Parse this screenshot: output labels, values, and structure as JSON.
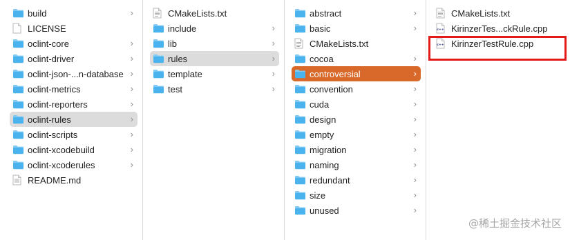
{
  "columns": [
    {
      "items": [
        {
          "label": "build",
          "icon": "folder-icon",
          "chevron": true,
          "selected": ""
        },
        {
          "label": "LICENSE",
          "icon": "document-icon",
          "chevron": false,
          "selected": ""
        },
        {
          "label": "oclint-core",
          "icon": "folder-icon",
          "chevron": true,
          "selected": ""
        },
        {
          "label": "oclint-driver",
          "icon": "folder-icon",
          "chevron": true,
          "selected": ""
        },
        {
          "label": "oclint-json-...n-database",
          "icon": "folder-icon",
          "chevron": true,
          "selected": ""
        },
        {
          "label": "oclint-metrics",
          "icon": "folder-icon",
          "chevron": true,
          "selected": ""
        },
        {
          "label": "oclint-reporters",
          "icon": "folder-icon",
          "chevron": true,
          "selected": ""
        },
        {
          "label": "oclint-rules",
          "icon": "folder-icon",
          "chevron": true,
          "selected": "gray"
        },
        {
          "label": "oclint-scripts",
          "icon": "folder-icon",
          "chevron": true,
          "selected": ""
        },
        {
          "label": "oclint-xcodebuild",
          "icon": "folder-icon",
          "chevron": true,
          "selected": ""
        },
        {
          "label": "oclint-xcoderules",
          "icon": "folder-icon",
          "chevron": true,
          "selected": ""
        },
        {
          "label": "README.md",
          "icon": "markdown-file-icon",
          "chevron": false,
          "selected": ""
        }
      ]
    },
    {
      "items": [
        {
          "label": "CMakeLists.txt",
          "icon": "text-file-icon",
          "chevron": false,
          "selected": ""
        },
        {
          "label": "include",
          "icon": "folder-icon",
          "chevron": true,
          "selected": ""
        },
        {
          "label": "lib",
          "icon": "folder-icon",
          "chevron": true,
          "selected": ""
        },
        {
          "label": "rules",
          "icon": "folder-icon",
          "chevron": true,
          "selected": "gray"
        },
        {
          "label": "template",
          "icon": "folder-icon",
          "chevron": true,
          "selected": ""
        },
        {
          "label": "test",
          "icon": "folder-icon",
          "chevron": true,
          "selected": ""
        }
      ]
    },
    {
      "items": [
        {
          "label": "abstract",
          "icon": "folder-icon",
          "chevron": true,
          "selected": ""
        },
        {
          "label": "basic",
          "icon": "folder-icon",
          "chevron": true,
          "selected": ""
        },
        {
          "label": "CMakeLists.txt",
          "icon": "text-file-icon",
          "chevron": false,
          "selected": ""
        },
        {
          "label": "cocoa",
          "icon": "folder-icon",
          "chevron": true,
          "selected": ""
        },
        {
          "label": "controversial",
          "icon": "folder-icon",
          "chevron": true,
          "selected": "orange"
        },
        {
          "label": "convention",
          "icon": "folder-icon",
          "chevron": true,
          "selected": ""
        },
        {
          "label": "cuda",
          "icon": "folder-icon",
          "chevron": true,
          "selected": ""
        },
        {
          "label": "design",
          "icon": "folder-icon",
          "chevron": true,
          "selected": ""
        },
        {
          "label": "empty",
          "icon": "folder-icon",
          "chevron": true,
          "selected": ""
        },
        {
          "label": "migration",
          "icon": "folder-icon",
          "chevron": true,
          "selected": ""
        },
        {
          "label": "naming",
          "icon": "folder-icon",
          "chevron": true,
          "selected": ""
        },
        {
          "label": "redundant",
          "icon": "folder-icon",
          "chevron": true,
          "selected": ""
        },
        {
          "label": "size",
          "icon": "folder-icon",
          "chevron": true,
          "selected": ""
        },
        {
          "label": "unused",
          "icon": "folder-icon",
          "chevron": true,
          "selected": ""
        }
      ]
    },
    {
      "items": [
        {
          "label": "CMakeLists.txt",
          "icon": "text-file-icon",
          "chevron": false,
          "selected": ""
        },
        {
          "label": "KirinzerTes...ckRule.cpp",
          "icon": "cpp-file-icon",
          "chevron": false,
          "selected": ""
        },
        {
          "label": "KirinzerTestRule.cpp",
          "icon": "cpp-file-icon",
          "chevron": false,
          "selected": ""
        }
      ]
    }
  ],
  "chevron_glyph": "›",
  "cpp_badge": "c++",
  "watermark": "@稀土掘金技术社区",
  "colors": {
    "folder": "#4ab3ee",
    "folder_tab": "#7fcaf5",
    "selected_gray": "#dcdcdc",
    "selected_orange": "#d9692a",
    "highlight_box": "#e21a1a"
  }
}
